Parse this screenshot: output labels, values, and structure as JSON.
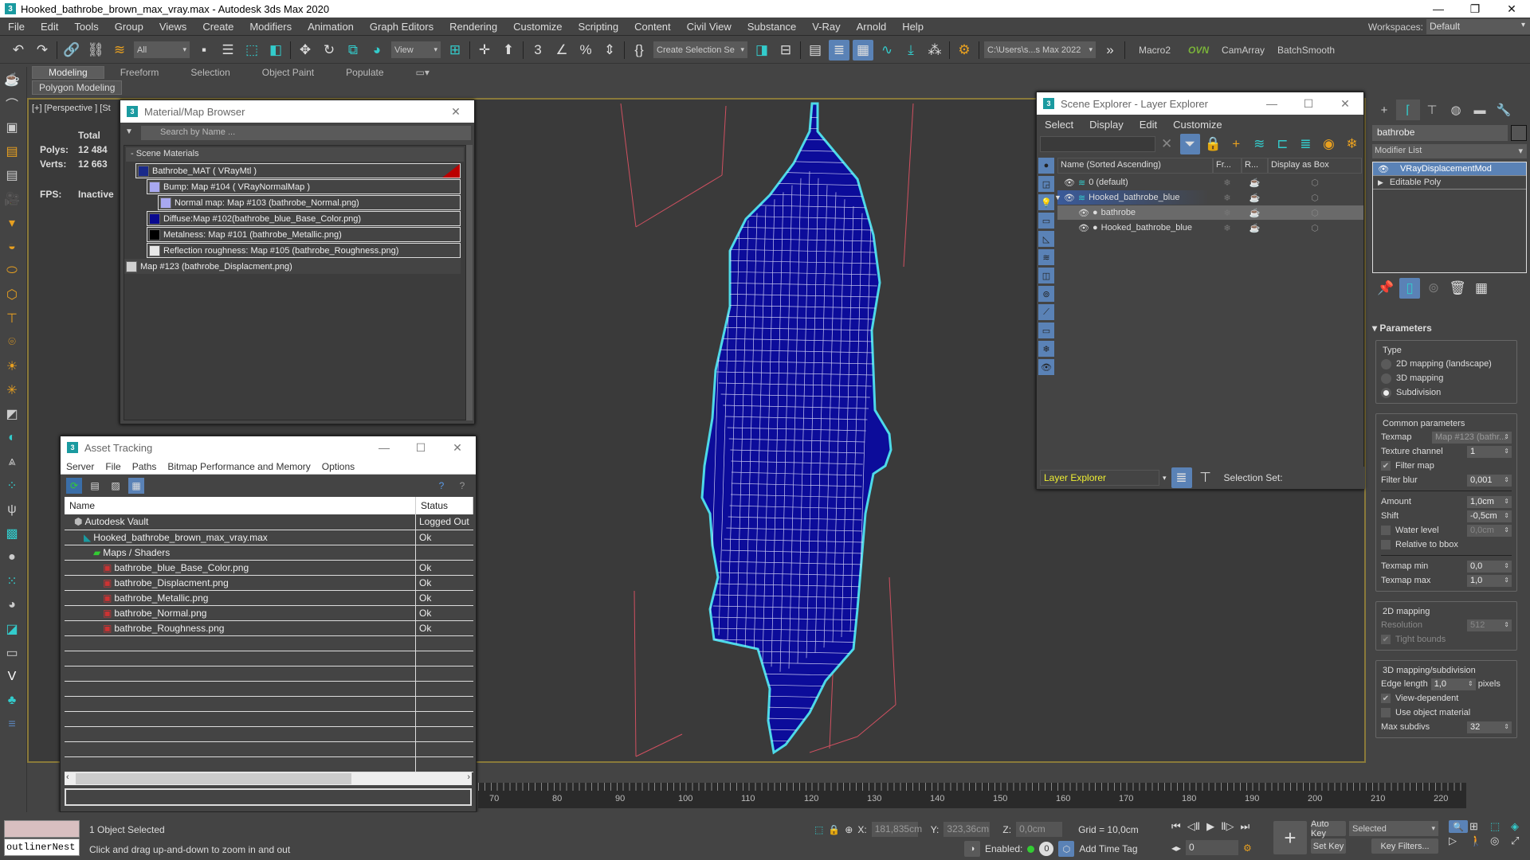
{
  "app": {
    "title": "Hooked_bathrobe_brown_max_vray.max - Autodesk 3ds Max 2020",
    "logo": "3",
    "window_controls": [
      "minimize-icon",
      "restore-icon",
      "close-icon"
    ]
  },
  "menu": [
    "File",
    "Edit",
    "Tools",
    "Group",
    "Views",
    "Create",
    "Modifiers",
    "Animation",
    "Graph Editors",
    "Rendering",
    "Customize",
    "Scripting",
    "Content",
    "Civil View",
    "Substance",
    "V-Ray",
    "Arnold",
    "Help"
  ],
  "workspaces": {
    "label": "Workspaces:",
    "value": "Default"
  },
  "toolbar": {
    "selection_filter": "All",
    "ref_coord": "View",
    "named_selection": "Create Selection Se",
    "project_path": "C:\\Users\\s...s Max 2022",
    "scripts": [
      "Macro2",
      "OVN",
      "CamArray",
      "BatchSmooth"
    ],
    "more": "»"
  },
  "ribbon": {
    "tabs": [
      "Modeling",
      "Freeform",
      "Selection",
      "Object Paint",
      "Populate"
    ],
    "active": "Modeling",
    "sub": "Polygon Modeling"
  },
  "viewport": {
    "label": "[+] [Perspective ] [St",
    "stats": {
      "header": "Total",
      "polys_label": "Polys:",
      "polys": "12 484",
      "verts_label": "Verts:",
      "verts": "12 663",
      "fps_label": "FPS:",
      "fps": "Inactive"
    },
    "wire_color": "#4dd9e8",
    "fill_color": "#0c0c9a"
  },
  "material_browser": {
    "title": "Material/Map Browser",
    "search_placeholder": "Search by Name ...",
    "group": "- Scene Materials",
    "items": [
      {
        "label": "Bathrobe_MAT  ( VRayMtl )",
        "swatch": "#1a2a8a",
        "indent": 0
      },
      {
        "label": "Bump: Map #104  ( VRayNormalMap )",
        "swatch": "#a8a8f0",
        "indent": 1
      },
      {
        "label": "Normal map: Map #103 (bathrobe_Normal.png)",
        "swatch": "#a8a8f0",
        "indent": 2
      },
      {
        "label": "Diffuse:Map #102(bathrobe_blue_Base_Color.png)",
        "swatch": "#0a0a90",
        "indent": 1
      },
      {
        "label": "Metalness: Map #101 (bathrobe_Metallic.png)",
        "swatch": "#000000",
        "indent": 1
      },
      {
        "label": "Reflection roughness: Map #105 (bathrobe_Roughness.png)",
        "swatch": "#e8e8e8",
        "indent": 1
      },
      {
        "label": "Map #123 (bathrobe_Displacment.png)",
        "swatch": "#d0d0d0",
        "indent": 0
      }
    ]
  },
  "asset_tracking": {
    "title": "Asset Tracking",
    "menu": [
      "Server",
      "File",
      "Paths",
      "Bitmap Performance and Memory",
      "Options"
    ],
    "columns": [
      "Name",
      "Status"
    ],
    "rows": [
      {
        "name": "Autodesk Vault",
        "status": "Logged Out",
        "indent": 1,
        "icon": "vault-icon"
      },
      {
        "name": "Hooked_bathrobe_brown_max_vray.max",
        "status": "Ok",
        "indent": 2,
        "icon": "max-file-icon"
      },
      {
        "name": "Maps / Shaders",
        "status": "",
        "indent": 3,
        "icon": "maps-icon"
      },
      {
        "name": "bathrobe_blue_Base_Color.png",
        "status": "Ok",
        "indent": 4,
        "icon": "png-icon"
      },
      {
        "name": "bathrobe_Displacment.png",
        "status": "Ok",
        "indent": 4,
        "icon": "png-icon"
      },
      {
        "name": "bathrobe_Metallic.png",
        "status": "Ok",
        "indent": 4,
        "icon": "png-icon"
      },
      {
        "name": "bathrobe_Normal.png",
        "status": "Ok",
        "indent": 4,
        "icon": "png-icon"
      },
      {
        "name": "bathrobe_Roughness.png",
        "status": "Ok",
        "indent": 4,
        "icon": "png-icon"
      }
    ]
  },
  "scene_explorer": {
    "title": "Scene Explorer - Layer Explorer",
    "menu": [
      "Select",
      "Display",
      "Edit",
      "Customize"
    ],
    "columns": [
      "Name (Sorted Ascending)",
      "Fr...",
      "R...",
      "Display as Box"
    ],
    "rows": [
      {
        "name": "0 (default)",
        "indent": 0,
        "selected": false
      },
      {
        "name": "Hooked_bathrobe_blue",
        "indent": 0,
        "selected": true,
        "expanded": true
      },
      {
        "name": "bathrobe",
        "indent": 1,
        "selected": false,
        "highlight": true
      },
      {
        "name": "Hooked_bathrobe_blue",
        "indent": 1,
        "selected": false
      }
    ],
    "footer": {
      "explorer": "Layer Explorer",
      "selection_set": "Selection Set:"
    }
  },
  "command_panel": {
    "object_name": "bathrobe",
    "modifier_list": "Modifier List",
    "stack": [
      "VRayDisplacementMod",
      "Editable Poly"
    ],
    "rollout": "Parameters",
    "type_label": "Type",
    "types": [
      {
        "label": "2D mapping (landscape)",
        "on": false
      },
      {
        "label": "3D mapping",
        "on": false
      },
      {
        "label": "Subdivision",
        "on": true
      }
    ],
    "common": "Common parameters",
    "texmap_label": "Texmap",
    "texmap": "Map #123 (bathr...",
    "texchan_label": "Texture channel",
    "texchan": "1",
    "filter_map": "Filter map",
    "filter_blur_label": "Filter blur",
    "filter_blur": "0,001",
    "amount_label": "Amount",
    "amount": "1,0cm",
    "shift_label": "Shift",
    "shift": "-0,5cm",
    "water_label": "Water level",
    "water": "0,0cm",
    "relbbox": "Relative to bbox",
    "tmin_label": "Texmap min",
    "tmin": "0,0",
    "tmax_label": "Texmap max",
    "tmax": "1,0",
    "map2d": "2D mapping",
    "res_label": "Resolution",
    "res": "512",
    "tight": "Tight bounds",
    "map3d": "3D mapping/subdivision",
    "edge_label": "Edge length",
    "edge": "1,0",
    "edge_unit": "pixels",
    "viewdep": "View-dependent",
    "useobj": "Use object material",
    "maxsub_label": "Max subdivs",
    "maxsub": "32"
  },
  "timeline": {
    "ticks": [
      "70",
      "80",
      "90",
      "100",
      "110",
      "120",
      "130",
      "140",
      "150",
      "160",
      "170",
      "180",
      "190",
      "200",
      "210",
      "220"
    ]
  },
  "status": {
    "maxscript": "outlinerNest",
    "selected": "1 Object Selected",
    "prompt": "Click and drag up-and-down to zoom in and out",
    "x_label": "X:",
    "x": "181,835cm",
    "y_label": "Y:",
    "y": "323,36cm",
    "z_label": "Z:",
    "z": "0,0cm",
    "grid": "Grid = 10,0cm",
    "enabled": "Enabled:",
    "enabled_count": "0",
    "add_time_tag": "Add Time Tag",
    "frame": "0",
    "auto_key": "Auto Key",
    "set_key": "Set Key",
    "key_mode": "Selected",
    "key_filters": "Key Filters..."
  }
}
